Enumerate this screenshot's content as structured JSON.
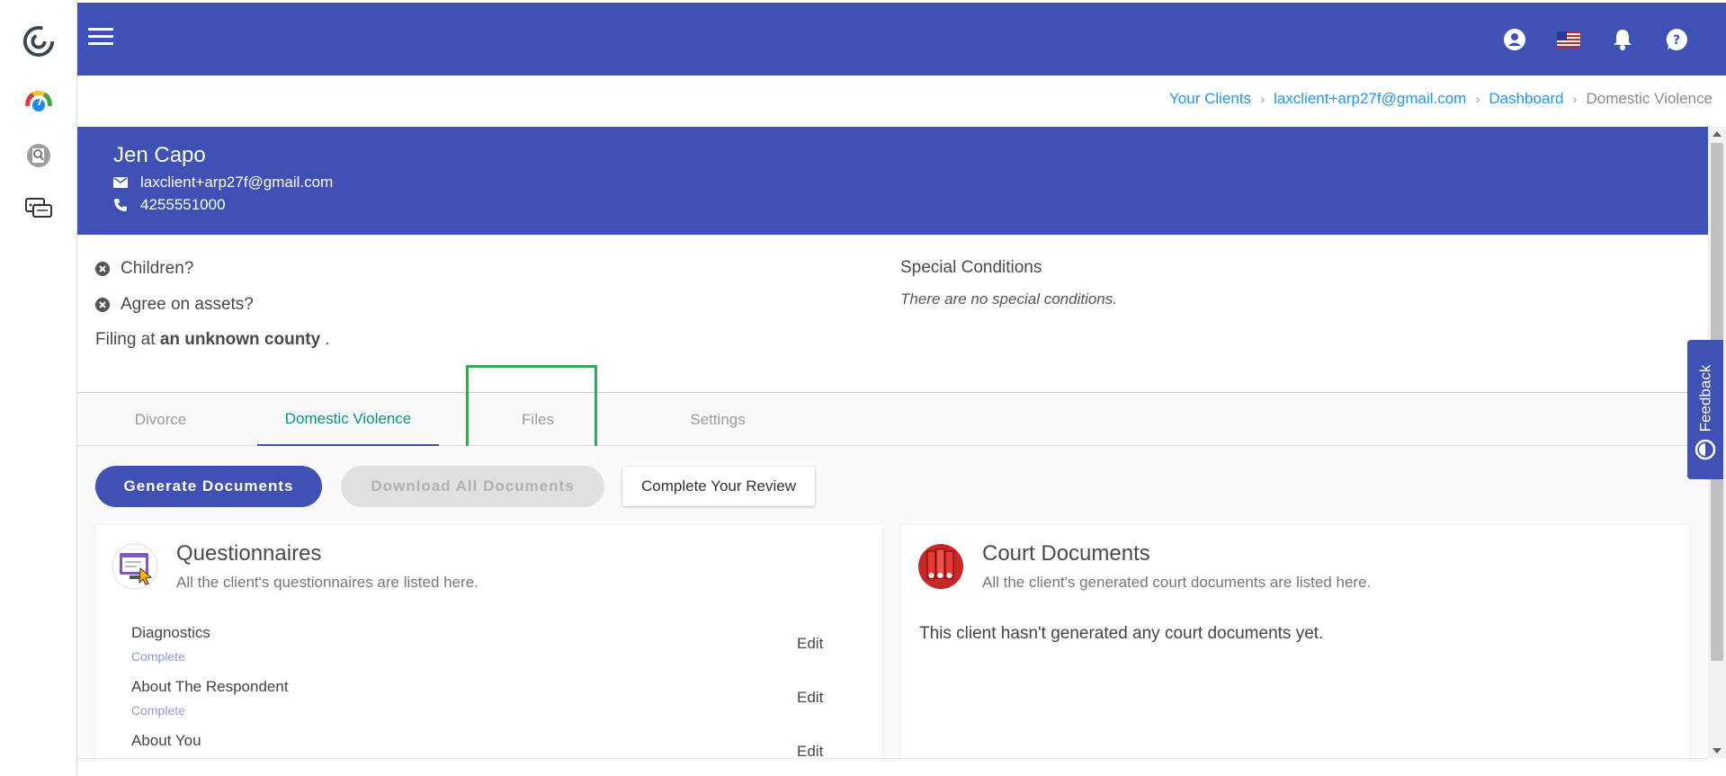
{
  "breadcrumb": {
    "items": [
      "Your Clients",
      "laxclient+arp27f@gmail.com",
      "Dashboard"
    ],
    "current": "Domestic Violence"
  },
  "client": {
    "name": "Jen Capo",
    "email": "laxclient+arp27f@gmail.com",
    "phone": "4255551000"
  },
  "conditions": {
    "children": "Children?",
    "assets": "Agree on assets?",
    "filing_prefix": "Filing at",
    "filing_county": "an unknown county",
    "filing_suffix": "."
  },
  "special": {
    "title": "Special Conditions",
    "text": "There are no special conditions."
  },
  "tabs": [
    {
      "label": "Divorce",
      "active": false
    },
    {
      "label": "Domestic Violence",
      "active": true
    },
    {
      "label": "Files",
      "active": false
    },
    {
      "label": "Settings",
      "active": false
    }
  ],
  "actions": {
    "generate": "Generate Documents",
    "download_all": "Download All Documents",
    "complete_review": "Complete Your Review"
  },
  "questionnaires": {
    "title": "Questionnaires",
    "subtitle": "All the client's questionnaires are listed here.",
    "items": [
      {
        "name": "Diagnostics",
        "status": "Complete",
        "edit": "Edit"
      },
      {
        "name": "About The Respondent",
        "status": "Complete",
        "edit": "Edit"
      },
      {
        "name": "About You",
        "status": "",
        "edit": "Edit"
      }
    ]
  },
  "court_documents": {
    "title": "Court Documents",
    "subtitle": "All the client's generated court documents are listed here.",
    "empty": "This client hasn't generated any court documents yet."
  },
  "feedback": {
    "label": "Feedback"
  },
  "icons": {
    "logo": "swirl-logo-icon",
    "dashboard": "gauge-icon",
    "search": "search-document-icon",
    "chat": "chat-bubbles-icon",
    "menu": "hamburger-menu-icon",
    "account": "account-circle-icon",
    "language": "us-flag-icon",
    "notifications": "bell-icon",
    "help": "help-icon"
  },
  "colors": {
    "primary": "#3f51b5",
    "active_tab_text": "#009688",
    "link": "#2196f3",
    "highlight": "#2fae4f"
  }
}
